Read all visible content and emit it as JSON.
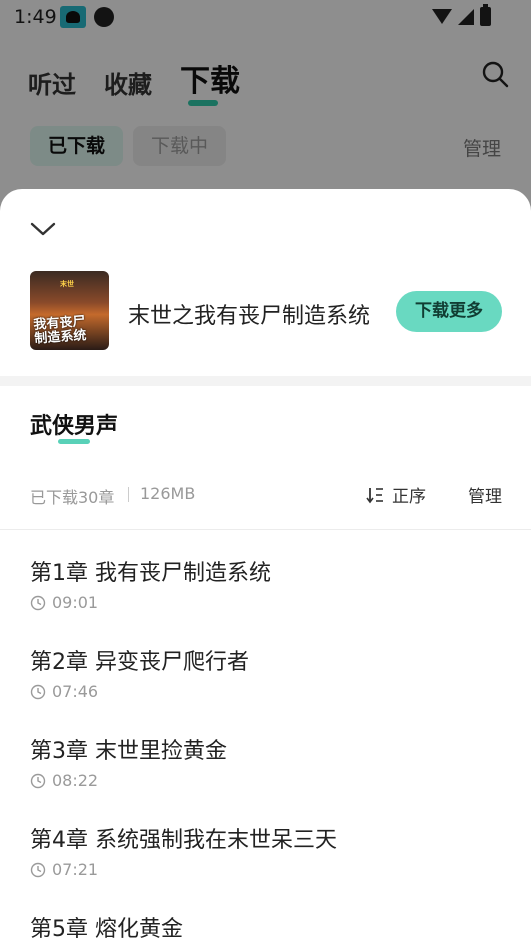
{
  "status_bar": {
    "time": "1:49"
  },
  "top_tabs": [
    {
      "label": "听过"
    },
    {
      "label": "收藏"
    },
    {
      "label": "下载"
    }
  ],
  "sub_tabs": [
    {
      "label": "已下载"
    },
    {
      "label": "下载中"
    }
  ],
  "bg_manage": "管理",
  "sheet": {
    "album_title": "末世之我有丧尸制造系统",
    "cover_text": "我有丧尸\n制造系统",
    "more_button": "下载更多",
    "section_title": "武侠男声",
    "downloaded_count": "已下载30章",
    "size": "126MB",
    "sort_label": "正序",
    "manage_label": "管理",
    "chapters": [
      {
        "title": "第1章  我有丧尸制造系统",
        "duration": "09:01"
      },
      {
        "title": "第2章  异变丧尸爬行者",
        "duration": "07:46"
      },
      {
        "title": "第3章  末世里捡黄金",
        "duration": "08:22"
      },
      {
        "title": "第4章  系统强制我在末世呆三天",
        "duration": "07:21"
      },
      {
        "title": "第5章  熔化黄金",
        "duration": ""
      }
    ]
  },
  "colors": {
    "accent": "#2fc5a6",
    "button_bg": "#69d9c1"
  }
}
